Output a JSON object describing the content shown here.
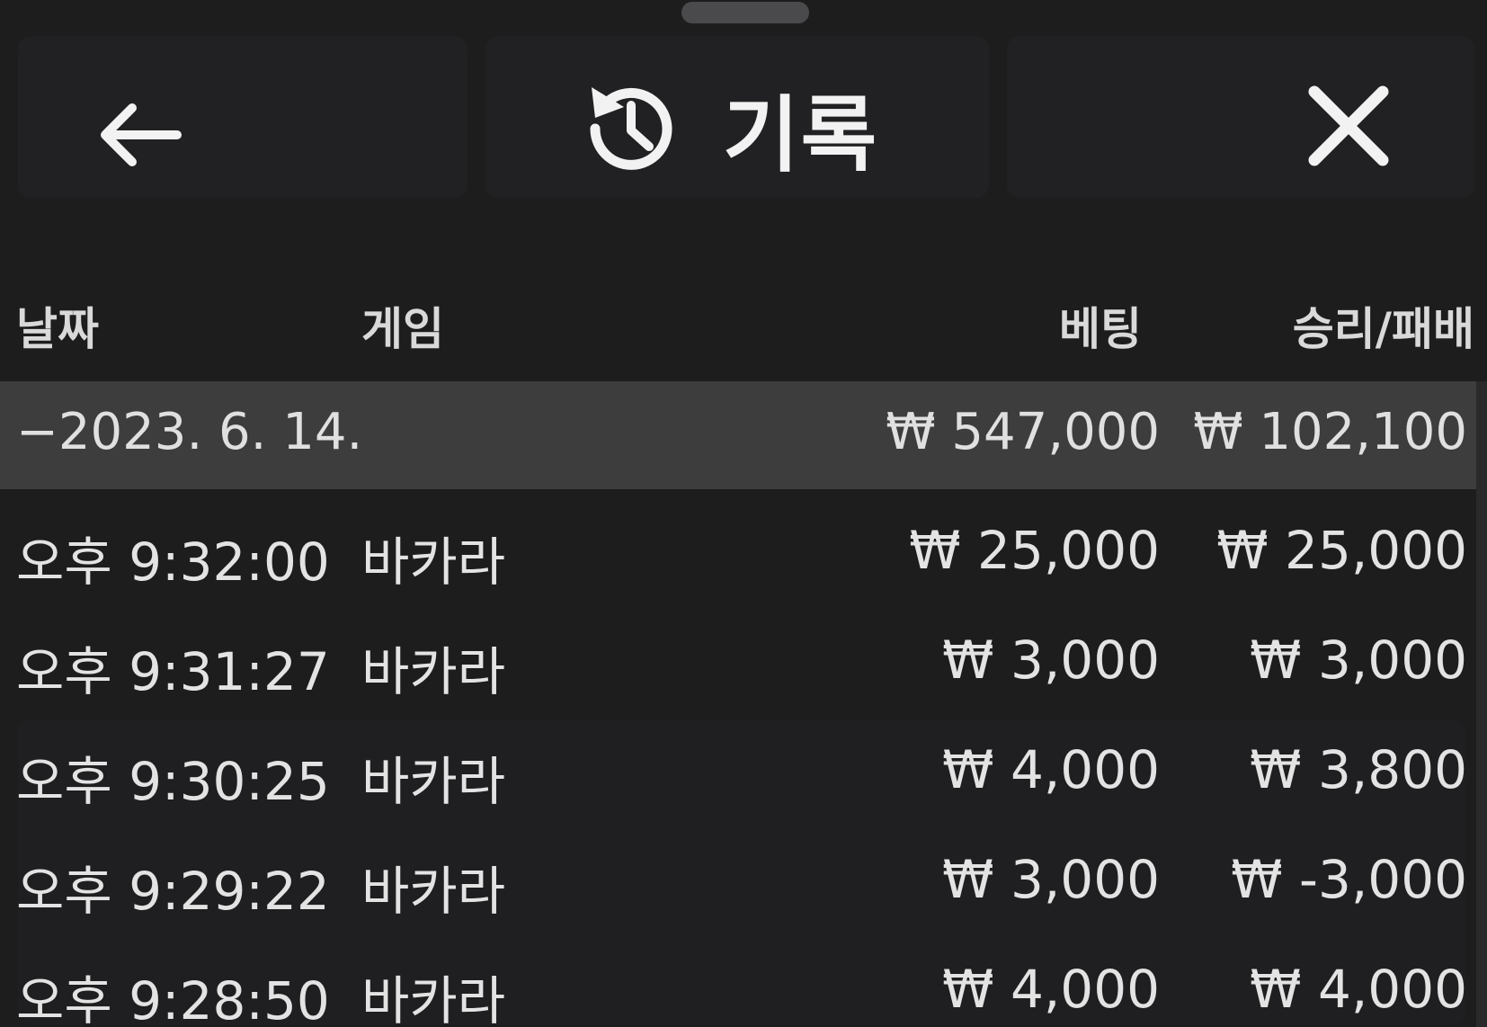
{
  "header": {
    "title": "기록",
    "back_icon": "arrow-left-icon",
    "history_icon": "history-icon",
    "close_icon": "close-icon"
  },
  "columns": {
    "date": "날짜",
    "game": "게임",
    "bet": "베팅",
    "result": "승리/패배"
  },
  "summary": {
    "date": "−2023. 6. 14.",
    "bet": "₩ 547,000",
    "result": "₩ 102,100"
  },
  "rows": [
    {
      "time": "오후 9:32:00",
      "game": "바카라",
      "bet": "₩ 25,000",
      "result": "₩ 25,000"
    },
    {
      "time": "오후 9:31:27",
      "game": "바카라",
      "bet": "₩ 3,000",
      "result": "₩ 3,000"
    },
    {
      "time": "오후 9:30:25",
      "game": "바카라",
      "bet": "₩ 4,000",
      "result": "₩ 3,800"
    },
    {
      "time": "오후 9:29:22",
      "game": "바카라",
      "bet": "₩ 3,000",
      "result": "₩ -3,000"
    },
    {
      "time": "오후 9:28:50",
      "game": "바카라",
      "bet": "₩ 4,000",
      "result": "₩ 4,000"
    }
  ],
  "colors": {
    "background": "#1d1d1e",
    "summary_row": "#3d3d3e",
    "text": "#e3e3e3"
  }
}
